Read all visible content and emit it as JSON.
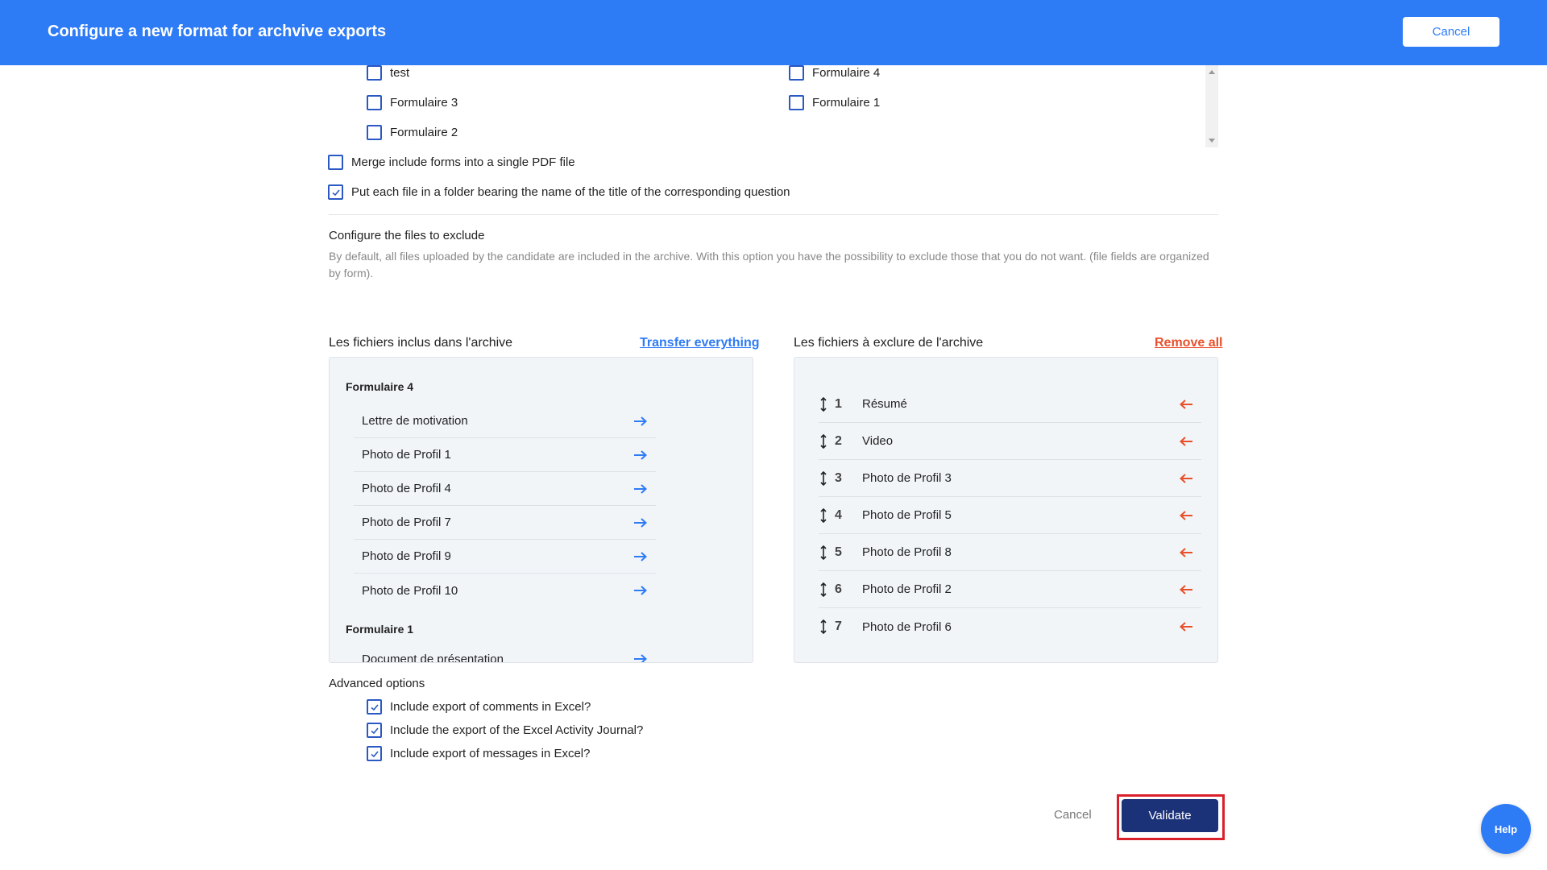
{
  "header": {
    "title": "Configure a new format for archvive exports",
    "cancel_label": "Cancel"
  },
  "forms_left": [
    {
      "label": "test",
      "checked": false
    },
    {
      "label": "Formulaire 3",
      "checked": false
    },
    {
      "label": "Formulaire 2",
      "checked": false
    }
  ],
  "forms_right": [
    {
      "label": "Formulaire 4",
      "checked": false
    },
    {
      "label": "Formulaire 1",
      "checked": false
    }
  ],
  "options": {
    "merge_label": "Merge include forms into a single PDF file",
    "merge_checked": false,
    "folder_label": "Put each file in a folder bearing the name of the title of the corresponding question",
    "folder_checked": true
  },
  "exclude_section": {
    "title": "Configure the files to exclude",
    "description": "By default, all files uploaded by the candidate are included in the archive. With this option you have the possibility to exclude those that you do not want. (file fields are organized by form)."
  },
  "included": {
    "title": "Les fichiers inclus dans l'archive",
    "action": "Transfer everything",
    "groups": [
      {
        "name": "Formulaire 4",
        "items": [
          "Lettre de motivation",
          "Photo de Profil 1",
          "Photo de Profil 4",
          "Photo de Profil 7",
          "Photo de Profil 9",
          "Photo de Profil 10"
        ]
      },
      {
        "name": "Formulaire 1",
        "items": [
          "Document de présentation"
        ]
      }
    ]
  },
  "excluded": {
    "title": "Les fichiers à exclure de l'archive",
    "action": "Remove all",
    "items": [
      {
        "num": "1",
        "label": "Résumé"
      },
      {
        "num": "2",
        "label": "Video"
      },
      {
        "num": "3",
        "label": "Photo de Profil 3"
      },
      {
        "num": "4",
        "label": "Photo de Profil 5"
      },
      {
        "num": "5",
        "label": "Photo de Profil 8"
      },
      {
        "num": "6",
        "label": "Photo de Profil 2"
      },
      {
        "num": "7",
        "label": "Photo de Profil 6"
      }
    ]
  },
  "advanced": {
    "title": "Advanced options",
    "items": [
      {
        "label": "Include export of comments in Excel?",
        "checked": true
      },
      {
        "label": "Include the export of the Excel Activity Journal?",
        "checked": true
      },
      {
        "label": "Include export of messages in Excel?",
        "checked": true
      }
    ]
  },
  "footer": {
    "cancel_label": "Cancel",
    "validate_label": "Validate",
    "help_label": "Help"
  },
  "colors": {
    "header_bg": "#2e7bf6",
    "checkbox_border": "#2b59c3",
    "link_blue": "#2e7bf6",
    "link_red": "#e8502a",
    "validate_bg": "#1c3278",
    "highlight_outline": "#d9202b"
  },
  "icons": {
    "include_action": "arrow-right-icon",
    "exclude_action": "arrow-left-icon",
    "reorder": "drag-handle-icon",
    "check": "check-icon"
  }
}
